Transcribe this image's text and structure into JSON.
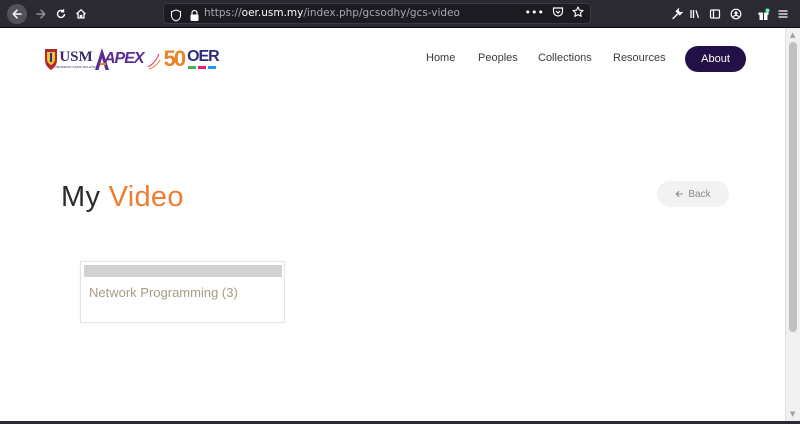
{
  "browser": {
    "url_prefix": "https://",
    "url_host": "oer.usm.my",
    "url_path": "/index.php/gcsodhy/gcs-video",
    "more_label": "•••"
  },
  "logos": {
    "usm": "USM",
    "usm_sub": "UNIVERSITI SAINS MALAYSIA",
    "apex": "APEX",
    "fifty": "50",
    "oer": "OER"
  },
  "nav": {
    "items": [
      {
        "label": "Home"
      },
      {
        "label": "Peoples"
      },
      {
        "label": "Collections"
      },
      {
        "label": "Resources"
      }
    ],
    "about_label": "About"
  },
  "page": {
    "title_main": "My",
    "title_accent": "Video",
    "back_label": "Back"
  },
  "cards": [
    {
      "title": "Network Programming (3)"
    }
  ],
  "colors": {
    "accent": "#ee7d2f",
    "about_bg": "#231047",
    "card_title": "#a79c85"
  }
}
